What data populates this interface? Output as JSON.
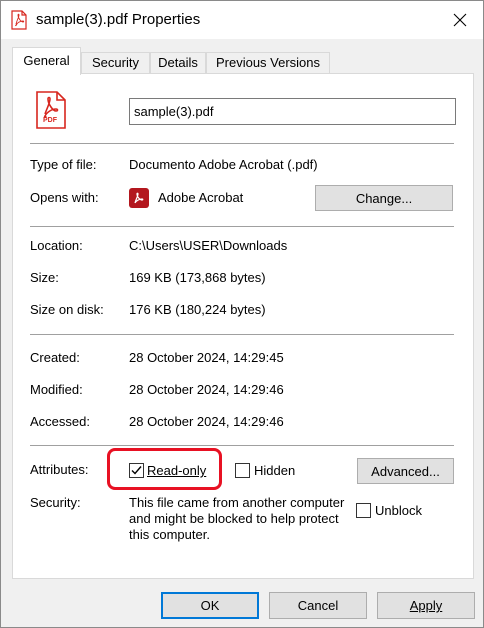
{
  "window": {
    "title": "sample(3).pdf Properties"
  },
  "tabs": [
    {
      "label": "General",
      "active": true
    },
    {
      "label": "Security",
      "active": false
    },
    {
      "label": "Details",
      "active": false
    },
    {
      "label": "Previous Versions",
      "active": false
    }
  ],
  "general": {
    "filename": "sample(3).pdf",
    "file_icon_text": "PDF",
    "type_label": "Type of file:",
    "type_value": "Documento Adobe Acrobat (.pdf)",
    "opens_label": "Opens with:",
    "opens_value": "Adobe Acrobat",
    "change_button": "Change...",
    "location_label": "Location:",
    "location_value": "C:\\Users\\USER\\Downloads",
    "size_label": "Size:",
    "size_value": "169 KB (173,868 bytes)",
    "size_disk_label": "Size on disk:",
    "size_disk_value": "176 KB (180,224 bytes)",
    "created_label": "Created:",
    "created_value": "28 October 2024, 14:29:45",
    "modified_label": "Modified:",
    "modified_value": "28 October 2024, 14:29:46",
    "accessed_label": "Accessed:",
    "accessed_value": "28 October 2024, 14:29:46",
    "attributes_label": "Attributes:",
    "readonly_label": "Read-only",
    "readonly_checked": true,
    "hidden_label": "Hidden",
    "hidden_checked": false,
    "advanced_button": "Advanced...",
    "security_label": "Security:",
    "security_text": "This file came from another computer and might be blocked to help protect this computer.",
    "unblock_label": "Unblock",
    "unblock_checked": false
  },
  "footer": {
    "ok": "OK",
    "cancel": "Cancel",
    "apply": "Apply"
  },
  "colors": {
    "pdf_red": "#d7261e",
    "highlight": "#e81123",
    "default_button_border": "#0078d7"
  }
}
